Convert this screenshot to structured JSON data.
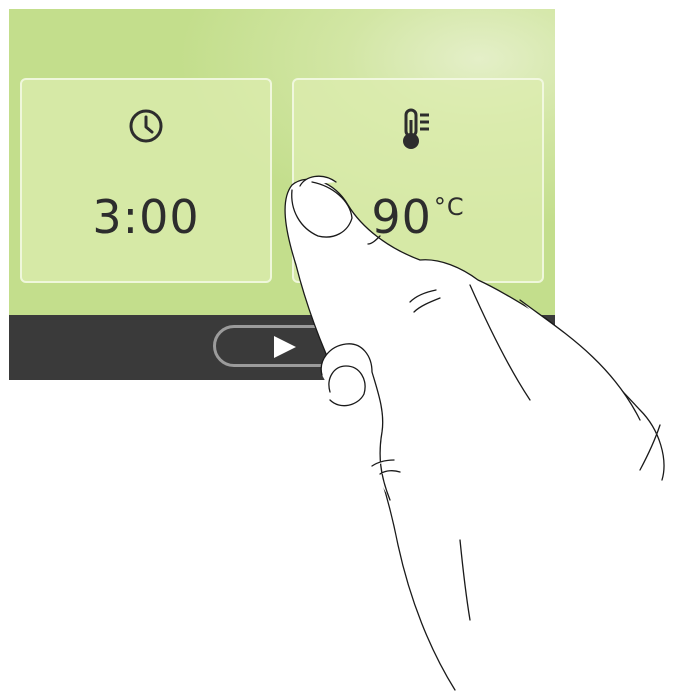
{
  "timer": {
    "icon": "clock-icon",
    "value": "3:00"
  },
  "temperature": {
    "icon": "thermometer-icon",
    "value": "90",
    "unit": "°C"
  },
  "controls": {
    "play_icon": "play-icon"
  },
  "colors": {
    "screen": "#c3de8c",
    "tile": "#dcecaf",
    "bar": "#3a3a3a",
    "button_border": "#9b9b9b",
    "text": "#2d2d2d"
  }
}
